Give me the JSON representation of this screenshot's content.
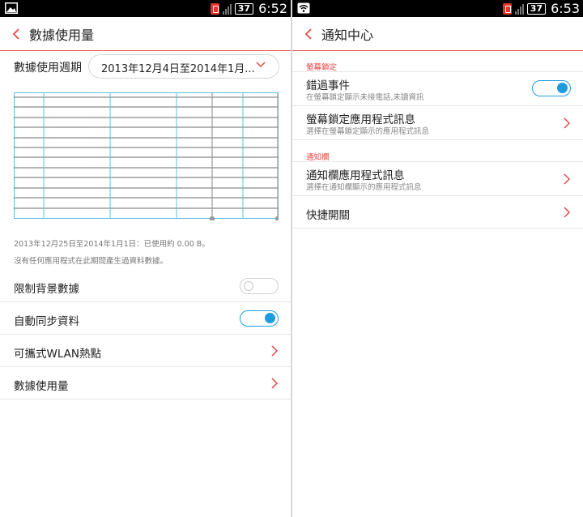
{
  "colors": {
    "accent": "#e84545",
    "toggle_on": "#1f9ce0",
    "status_bar": "#000000"
  },
  "left": {
    "status": {
      "battery": "37",
      "time": "6:52"
    },
    "title": "數據使用量",
    "period": {
      "label": "數據使用週期",
      "value": "2013年12月4日至2014年1月..."
    },
    "info_range": "2013年12月25日至2014年1月1日：已使用約 0.00 B。",
    "info_none": "沒有任何應用程式在此期間產生過資料數據。",
    "rows": [
      {
        "label": "限制背景數據",
        "control": "toggle",
        "on": false
      },
      {
        "label": "自動同步資料",
        "control": "toggle",
        "on": true
      },
      {
        "label": "可攜式WLAN熱點",
        "control": "chevron"
      },
      {
        "label": "數據使用量",
        "control": "chevron"
      }
    ]
  },
  "right": {
    "status": {
      "battery": "37",
      "time": "6:53"
    },
    "title": "通知中心",
    "sections": [
      {
        "header": "螢幕鎖定",
        "items": [
          {
            "title": "錯過事件",
            "subtitle": "在螢幕鎖定顯示未接電話,未讀資訊",
            "control": "toggle",
            "on": true
          },
          {
            "title": "螢幕鎖定應用程式訊息",
            "subtitle": "選擇在螢幕鎖定顯示的應用程式訊息",
            "control": "chevron"
          }
        ]
      },
      {
        "header": "通知欄",
        "items": [
          {
            "title": "通知欄應用程式訊息",
            "subtitle": "選擇在通知欄顯示的應用程式訊息",
            "control": "chevron"
          }
        ]
      }
    ],
    "quick": {
      "title": "快捷開關",
      "control": "chevron"
    }
  }
}
